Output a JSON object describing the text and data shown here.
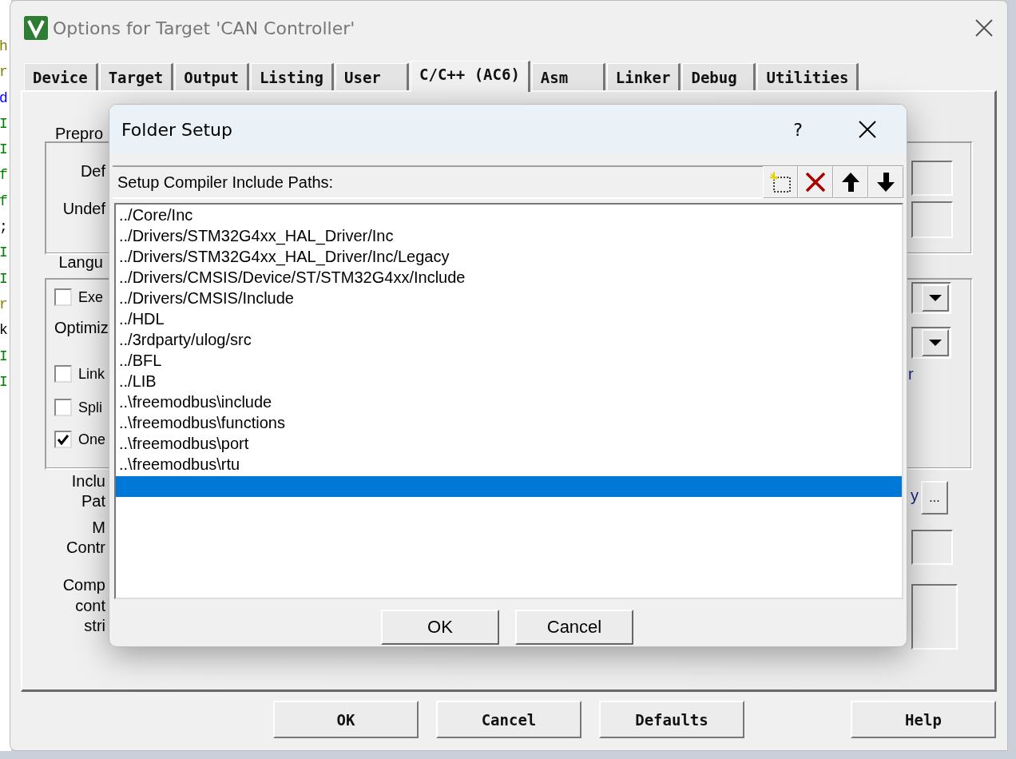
{
  "editor_margin": [
    {
      "text": "h",
      "color": "#808000"
    },
    {
      "text": "r",
      "color": "#808000"
    },
    {
      "text": "d",
      "color": "#0000ff"
    },
    {
      "text": "I",
      "color": "#008000"
    },
    {
      "text": "I",
      "color": "#008000"
    },
    {
      "text": "f",
      "color": "#008000"
    },
    {
      "text": "f",
      "color": "#008000"
    },
    {
      "text": ";",
      "color": "#000000"
    },
    {
      "text": "I",
      "color": "#008000"
    },
    {
      "text": "I",
      "color": "#008000"
    },
    {
      "text": "r",
      "color": "#808000"
    },
    {
      "text": "k",
      "color": "#000000"
    },
    {
      "text": "I",
      "color": "#008000"
    },
    {
      "text": "I",
      "color": "#008000"
    }
  ],
  "window": {
    "title": "Options for Target 'CAN Controller'"
  },
  "tabs": [
    {
      "label": "Device",
      "selected": false
    },
    {
      "label": "Target",
      "selected": false
    },
    {
      "label": "Output",
      "selected": false
    },
    {
      "label": "Listing",
      "selected": false
    },
    {
      "label": "User",
      "selected": false
    },
    {
      "label": "C/C++ (AC6)",
      "selected": true
    },
    {
      "label": "Asm",
      "selected": false
    },
    {
      "label": "Linker",
      "selected": false
    },
    {
      "label": "Debug",
      "selected": false
    },
    {
      "label": "Utilities",
      "selected": false
    }
  ],
  "panel_left": [
    {
      "kind": "group",
      "text": "Prepro"
    },
    {
      "kind": "label",
      "text": "Def"
    },
    {
      "kind": "label",
      "text": "Undef"
    },
    {
      "kind": "group",
      "text": "Langu"
    },
    {
      "kind": "checkbox",
      "text": "Exe",
      "checked": false
    },
    {
      "kind": "label",
      "text": "Optimiz"
    },
    {
      "kind": "checkbox",
      "text": "Link",
      "checked": false
    },
    {
      "kind": "checkbox",
      "text": "Spli",
      "checked": false
    },
    {
      "kind": "checkbox",
      "text": "One",
      "checked": true
    },
    {
      "kind": "label",
      "text": "Inclu"
    },
    {
      "kind": "label",
      "text": "Pat"
    },
    {
      "kind": "label",
      "text": "M"
    },
    {
      "kind": "label",
      "text": "Contr"
    },
    {
      "kind": "label",
      "text": "Comp"
    },
    {
      "kind": "label",
      "text": "cont"
    },
    {
      "kind": "label",
      "text": "stri"
    }
  ],
  "panel_right": {
    "option_text": "r",
    "include_text": "y",
    "browse_button": "..."
  },
  "dialog": {
    "title": "Folder Setup",
    "help": "?",
    "toolbar_label": "Setup Compiler Include Paths:",
    "paths": [
      {
        "text": "../Core/Inc",
        "selected": false
      },
      {
        "text": "../Drivers/STM32G4xx_HAL_Driver/Inc",
        "selected": false
      },
      {
        "text": "../Drivers/STM32G4xx_HAL_Driver/Inc/Legacy",
        "selected": false
      },
      {
        "text": "../Drivers/CMSIS/Device/ST/STM32G4xx/Include",
        "selected": false
      },
      {
        "text": "../Drivers/CMSIS/Include",
        "selected": false
      },
      {
        "text": "../HDL",
        "selected": false
      },
      {
        "text": "../3rdparty/ulog/src",
        "selected": false
      },
      {
        "text": "../BFL",
        "selected": false
      },
      {
        "text": "../LIB",
        "selected": false
      },
      {
        "text": "..\\freemodbus\\include",
        "selected": false
      },
      {
        "text": "..\\freemodbus\\functions",
        "selected": false
      },
      {
        "text": "..\\freemodbus\\port",
        "selected": false
      },
      {
        "text": "..\\freemodbus\\rtu",
        "selected": false
      },
      {
        "selected": true
      }
    ],
    "buttons": [
      "OK",
      "Cancel"
    ]
  },
  "buttons": [
    "OK",
    "Cancel",
    "Defaults",
    "Help"
  ]
}
